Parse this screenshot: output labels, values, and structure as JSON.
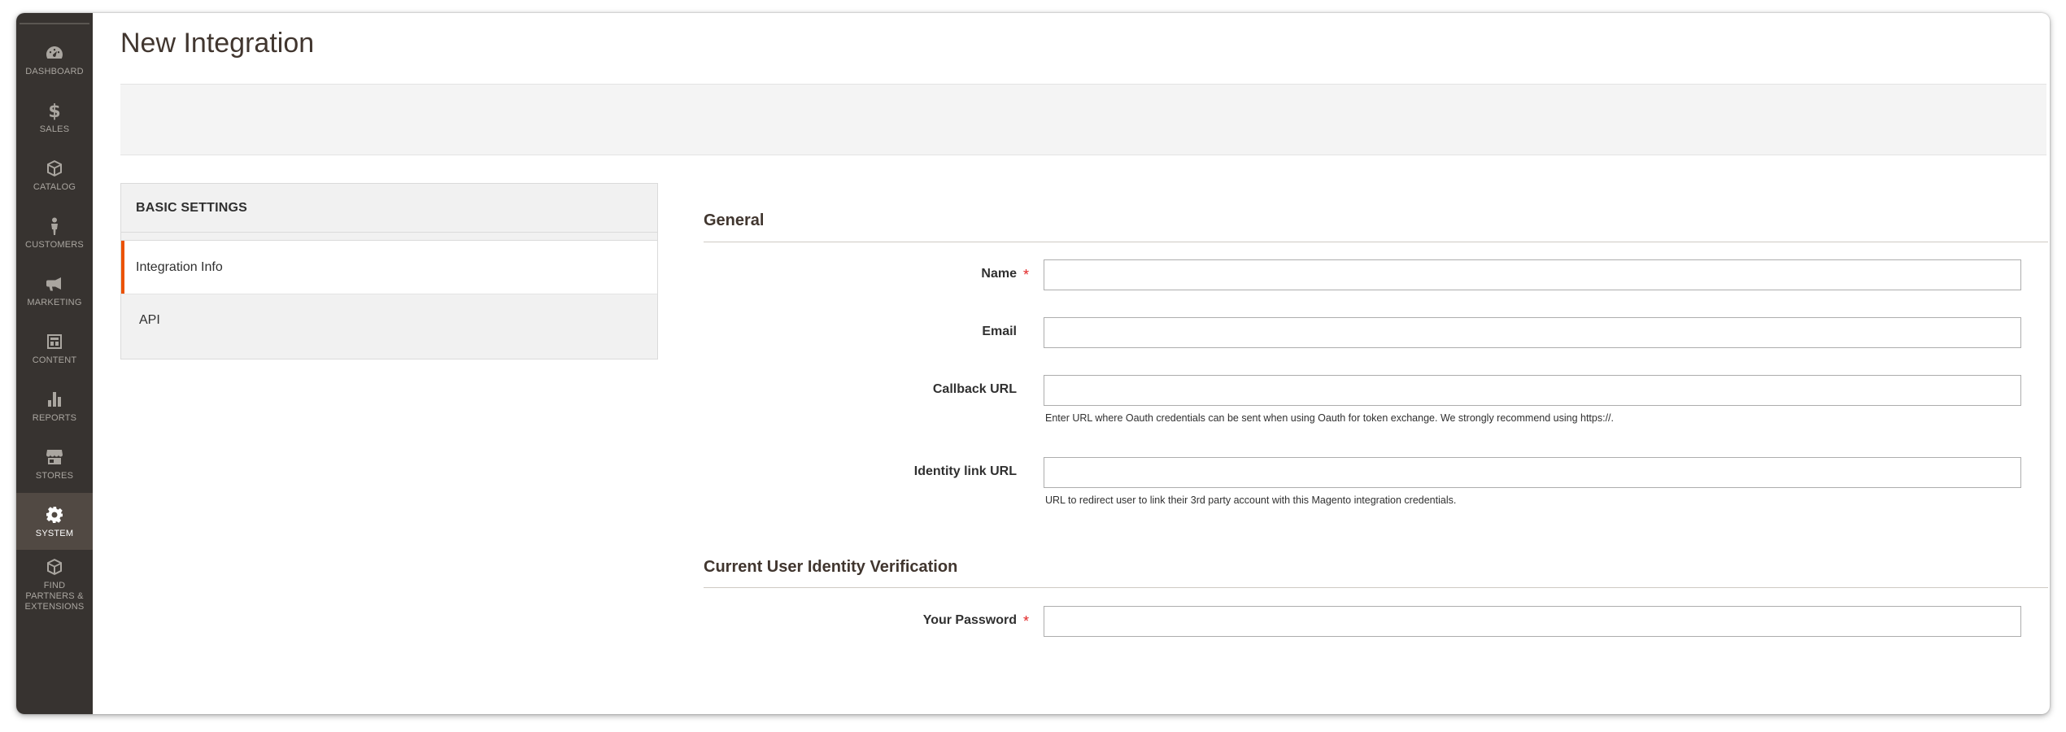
{
  "sidebar": {
    "items": [
      {
        "label": "DASHBOARD",
        "icon": "dashboard-icon"
      },
      {
        "label": "SALES",
        "icon": "dollar-icon"
      },
      {
        "label": "CATALOG",
        "icon": "box-icon"
      },
      {
        "label": "CUSTOMERS",
        "icon": "person-icon"
      },
      {
        "label": "MARKETING",
        "icon": "megaphone-icon"
      },
      {
        "label": "CONTENT",
        "icon": "layout-icon"
      },
      {
        "label": "REPORTS",
        "icon": "bar-chart-icon"
      },
      {
        "label": "STORES",
        "icon": "store-icon"
      },
      {
        "label": "SYSTEM",
        "icon": "gear-icon"
      },
      {
        "label": "FIND PARTNERS & EXTENSIONS",
        "icon": "cube-icon"
      }
    ],
    "active": "SYSTEM"
  },
  "page": {
    "title": "New Integration"
  },
  "tabs": {
    "title": "BASIC SETTINGS",
    "items": [
      {
        "label": "Integration Info",
        "active": true
      },
      {
        "label": "API",
        "active": false
      }
    ]
  },
  "form": {
    "general": {
      "title": "General",
      "name_label": "Name",
      "name_value": "",
      "email_label": "Email",
      "email_value": "",
      "callback_label": "Callback URL",
      "callback_value": "",
      "callback_note": "Enter URL where Oauth credentials can be sent when using Oauth for token exchange. We strongly recommend using https://.",
      "identity_label": "Identity link URL",
      "identity_value": "",
      "identity_note": "URL to redirect user to link their 3rd party account with this Magento integration credentials."
    },
    "verification": {
      "title": "Current User Identity Verification",
      "password_label": "Your Password",
      "password_value": ""
    },
    "required_mark": "*"
  },
  "colors": {
    "sidebar_bg": "#373330",
    "sidebar_active": "#514943",
    "accent": "#eb5202",
    "required": "#e22626"
  }
}
